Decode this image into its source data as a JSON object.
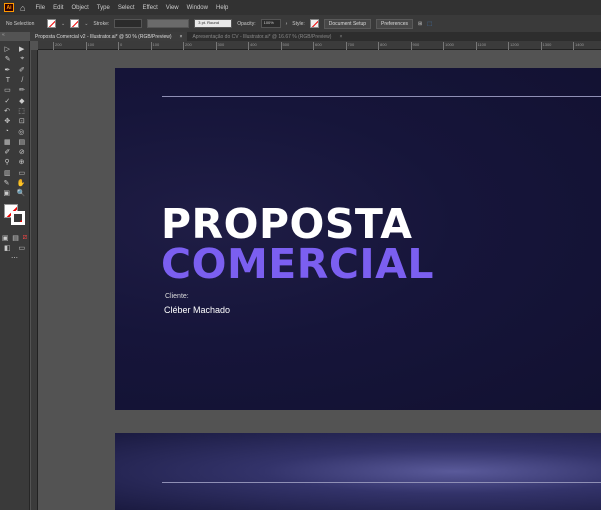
{
  "app": {
    "logo": "Ai"
  },
  "menu": [
    "File",
    "Edit",
    "Object",
    "Type",
    "Select",
    "Effect",
    "View",
    "Window",
    "Help"
  ],
  "control": {
    "selection": "No Selection",
    "stroke_label": "Stroke:",
    "brush": "3 pt. Round",
    "opacity_label": "Opacity:",
    "opacity": "100%",
    "style_label": "Style:",
    "document_setup": "Document Setup",
    "preferences": "Preferences"
  },
  "tabs": [
    {
      "label": "Proposta Comercial v2 - Illustrator.ai* @ 50 % (RGB/Preview)",
      "close": "×"
    },
    {
      "label": "Apresentação do CV - Illustrator.ai* @ 16.67 % (RGB/Preview)",
      "close": "×"
    }
  ],
  "ruler": [
    "200",
    "100",
    "0",
    "100",
    "200",
    "300",
    "400",
    "500",
    "600",
    "700",
    "800",
    "900",
    "1000",
    "1100",
    "1200",
    "1300",
    "1400",
    "1500"
  ],
  "tools": [
    [
      "▷",
      "▶"
    ],
    [
      "✎",
      "⌖"
    ],
    [
      "✒",
      "✐"
    ],
    [
      "T",
      "/"
    ],
    [
      "▭",
      "✏"
    ],
    [
      "✓",
      "◆"
    ],
    [
      "↶",
      "⬚"
    ],
    [
      "✥",
      "⊡"
    ],
    [
      "◔",
      "◎"
    ],
    [
      "▦",
      "▤"
    ],
    [
      "✐",
      "⊘"
    ],
    [
      "⚲",
      "⊕"
    ],
    [
      "▥",
      "▭"
    ],
    [
      "✎",
      "✋"
    ],
    [
      "▣",
      "🔍"
    ]
  ],
  "artboard": {
    "title_line1": "PROPOSTA",
    "title_line2": "COMERCIAL",
    "client_label": "Cliente:",
    "client_name": "Cléber Machado"
  },
  "colors": {
    "accent": "#7b5ff0",
    "artboard_bg": "#16153a"
  }
}
